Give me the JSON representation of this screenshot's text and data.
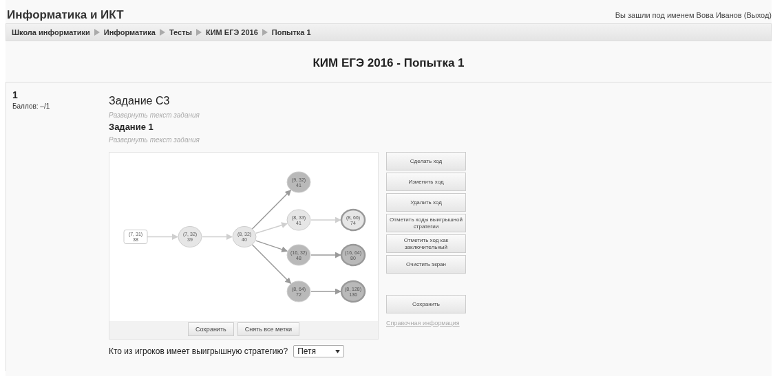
{
  "header": {
    "site_title": "Информатика и ИКТ",
    "login_text": "Вы зашли под именем Вова Иванов",
    "logout_link": "(Выход)"
  },
  "breadcrumbs": [
    "Школа информатики",
    "Информатика",
    "Тесты",
    "КИМ ЕГЭ 2016",
    "Попытка 1"
  ],
  "page_title": "КИМ ЕГЭ 2016 - Попытка 1",
  "question": {
    "number": "1",
    "score": "Баллов: –/1",
    "title": "Задание C3",
    "expand_1": "Развернуть текст задания",
    "subtitle": "Задание 1",
    "expand_2": "Развернуть текст задания",
    "graph": {
      "root": {
        "kind": "start",
        "final": false,
        "label": "(7, 31)",
        "value": "38",
        "children": [
          {
            "kind": "plain",
            "final": false,
            "label": "(7, 32)",
            "value": "39",
            "children": [
              {
                "kind": "plain",
                "final": false,
                "label": "(8, 32)",
                "value": "40",
                "children": [
                  {
                    "kind": "winning",
                    "final": false,
                    "label": "(9, 32)",
                    "value": "41"
                  },
                  {
                    "kind": "plain",
                    "final": false,
                    "label": "(8, 33)",
                    "value": "41",
                    "children": [
                      {
                        "kind": "plain",
                        "final": true,
                        "label": "(8, 66)",
                        "value": "74"
                      }
                    ]
                  },
                  {
                    "kind": "winning",
                    "final": false,
                    "label": "(16, 32)",
                    "value": "48",
                    "children": [
                      {
                        "kind": "winning",
                        "final": true,
                        "label": "(16, 64)",
                        "value": "80"
                      }
                    ]
                  },
                  {
                    "kind": "winning",
                    "final": false,
                    "label": "(8, 64)",
                    "value": "72",
                    "children": [
                      {
                        "kind": "winning",
                        "final": true,
                        "label": "(8, 128)",
                        "value": "136"
                      }
                    ]
                  }
                ]
              }
            ]
          }
        ]
      }
    },
    "graph_buttons": [
      "Сохранить",
      "Снять все метки"
    ],
    "side_buttons": [
      "Сделать ход",
      "Изменить ход",
      "Удалить ход",
      "Отметить ходы выигрышной стратегии",
      "Отметить ход как заключительный",
      "Очистить экран"
    ],
    "save_button": "Сохранить",
    "help_link": "Справочная информация",
    "answer_label": "Кто из игроков имеет выигрышную стратегию?",
    "answer_value": "Петя"
  }
}
